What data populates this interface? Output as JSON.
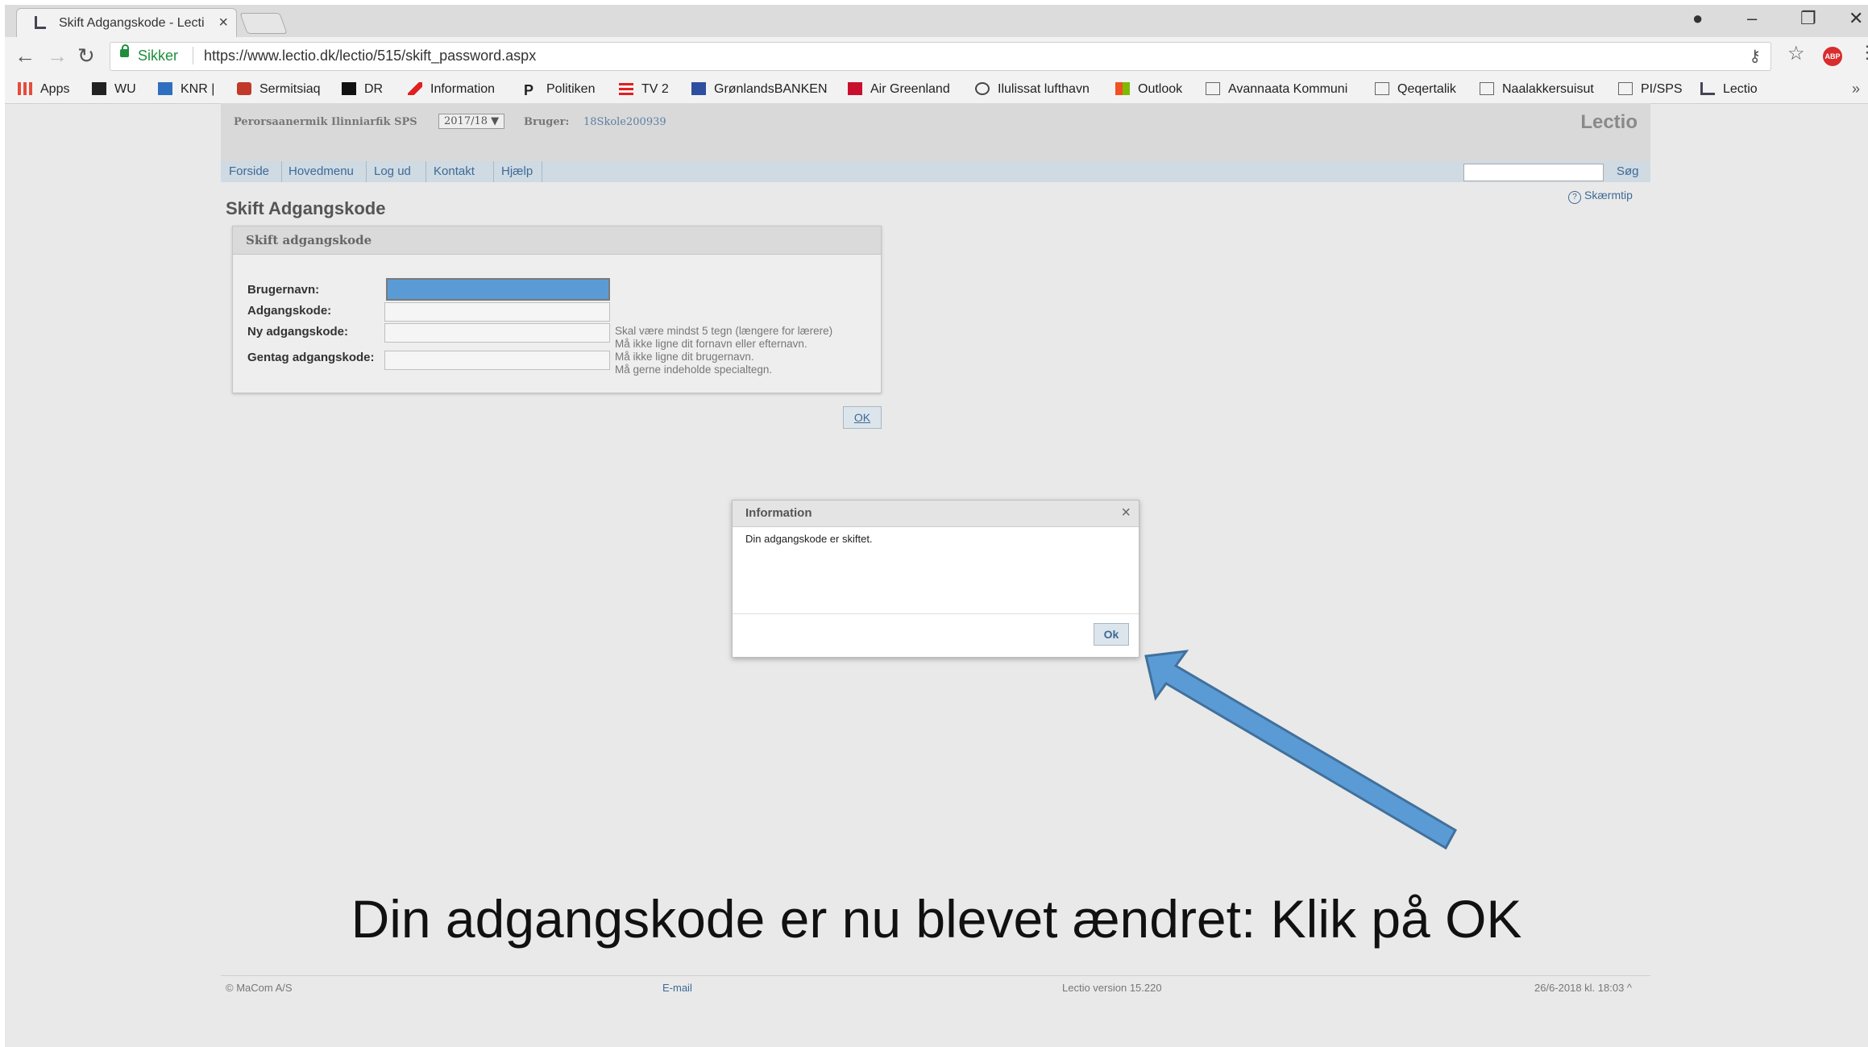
{
  "browser": {
    "tab_title": "Skift Adgangskode - Lecti",
    "tab_close": "×",
    "secure_label": "Sikker",
    "url": "https://www.lectio.dk/lectio/515/skift_password.aspx",
    "bookmarks": [
      "Apps",
      "WU",
      "KNR |",
      "Sermitsiaq",
      "DR",
      "Information",
      "Politiken",
      "TV 2",
      "GrønlandsBANKEN",
      "Air Greenland",
      "Ilulissat lufthavn",
      "Outlook",
      "Avannaata Kommuni",
      "Qeqertalik",
      "Naalakkersuisut",
      "PI/SPS",
      "Lectio"
    ],
    "more": "»"
  },
  "lectio": {
    "school": "Perorsaanermik Ilinniarfik SPS",
    "year": "2017/18 ▼",
    "user_label": "Bruger:",
    "user_value": "18Skole200939",
    "logo": "Lectio",
    "nav": [
      "Forside",
      "Hovedmenu",
      "Log ud",
      "Kontakt",
      "Hjælp"
    ],
    "search_button": "Søg",
    "screen_tip": "Skærmtip",
    "page_title": "Skift Adgangskode",
    "panel_title": "Skift adgangskode",
    "labels": {
      "username": "Brugernavn:",
      "password": "Adgangskode:",
      "new_password": "Ny adgangskode:",
      "repeat_password": "Gentag adgangskode:"
    },
    "hints": [
      "Skal være mindst 5 tegn (længere for lærere)",
      "Må ikke ligne dit fornavn eller efternavn.",
      "Må ikke ligne dit brugernavn.",
      "Må gerne indeholde specialtegn."
    ],
    "ok": "OK"
  },
  "dialog": {
    "title": "Information",
    "close": "×",
    "message": "Din adgangskode er skiftet.",
    "ok": "Ok"
  },
  "caption": "Din adgangskode er nu blevet ændret: Klik på OK",
  "footer": {
    "copyright": "© MaCom A/S",
    "email": "E-mail",
    "version": "Lectio version 15.220",
    "datetime": "26/6-2018  kl. 18:03 ^"
  },
  "colors": {
    "arrow": "#5b9bd5",
    "link": "#3d6a96",
    "secure": "#1e8e3e"
  }
}
